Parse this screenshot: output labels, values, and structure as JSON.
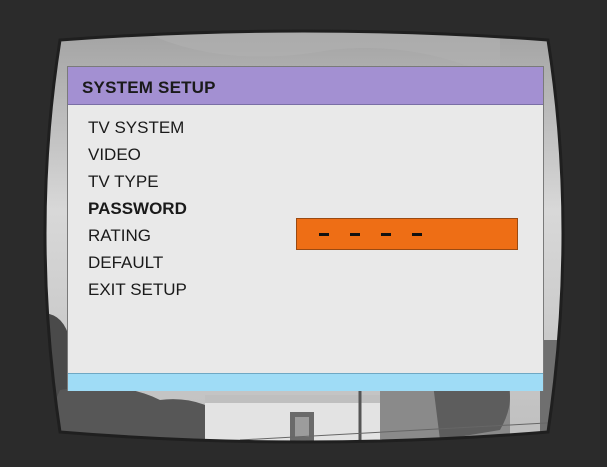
{
  "dialog": {
    "title": "SYSTEM SETUP",
    "menu_items": [
      {
        "label": "TV SYSTEM",
        "active": false
      },
      {
        "label": "VIDEO",
        "active": false
      },
      {
        "label": "TV TYPE",
        "active": false
      },
      {
        "label": "PASSWORD",
        "active": true
      },
      {
        "label": "RATING",
        "active": false
      },
      {
        "label": "DEFAULT",
        "active": false
      },
      {
        "label": "EXIT SETUP",
        "active": false
      }
    ],
    "password_entry": {
      "masked_digits": 4,
      "digits_entered": 0
    }
  },
  "colors": {
    "header": "#a390d2",
    "panel": "#e9e9e9",
    "highlight": "#ee6e15",
    "footer": "#9fdcf6",
    "bezel": "#2b2b2b"
  }
}
